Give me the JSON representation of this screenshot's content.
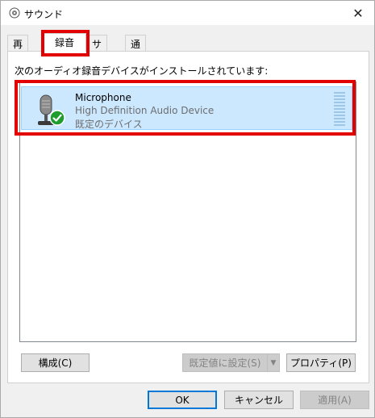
{
  "window": {
    "title": "サウンド",
    "close_symbol": "✕"
  },
  "tabs": [
    {
      "label": "再生"
    },
    {
      "label": "録音"
    },
    {
      "label": "サウンド"
    },
    {
      "label": "通信"
    }
  ],
  "instruction": "次のオーディオ録音デバイスがインストールされています:",
  "device": {
    "name": "Microphone",
    "description": "High Definition Audio Device",
    "status": "既定のデバイス",
    "icon": "microphone-icon",
    "status_icon": "check-badge-icon"
  },
  "buttons": {
    "configure": "構成(C)",
    "set_default": "既定値に設定(S)",
    "properties": "プロパティ(P)",
    "ok": "OK",
    "cancel": "キャンセル",
    "apply": "適用(A)"
  },
  "colors": {
    "highlight_red": "#e30000",
    "selection_bg": "#cce8ff",
    "check_green": "#1f9d2f",
    "default_button_border": "#0078d7"
  }
}
